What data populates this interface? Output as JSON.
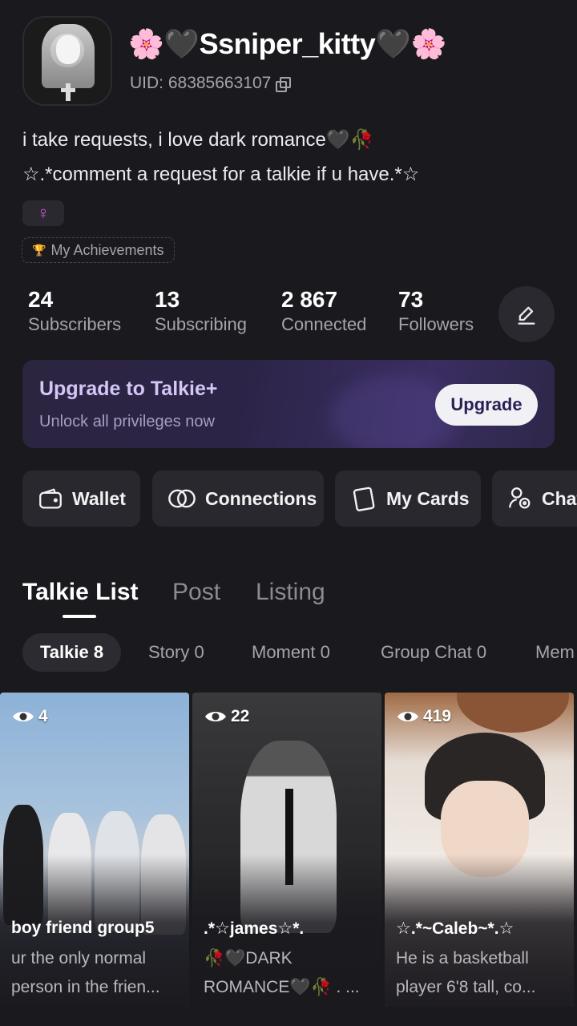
{
  "profile": {
    "username": "🌸🖤Ssniper_kitty🖤🌸",
    "uid": "UID: 68385663107",
    "bio_line1": "i take requests, i love dark romance🖤🥀",
    "bio_line2": "☆.*comment a request for a talkie if u have.*☆",
    "gender_symbol": "♀",
    "achievements_label": "My Achievements"
  },
  "stats": [
    {
      "value": "24",
      "label": "Subscribers"
    },
    {
      "value": "13",
      "label": "Subscribing"
    },
    {
      "value": "2 867",
      "label": "Connected"
    },
    {
      "value": "73",
      "label": "Followers"
    }
  ],
  "upgrade": {
    "title": "Upgrade to Talkie+",
    "subtitle": "Unlock all privileges now",
    "button": "Upgrade"
  },
  "quick_actions": [
    {
      "label": "Wallet",
      "icon": "wallet-icon"
    },
    {
      "label": "Connections",
      "icon": "connections-icon"
    },
    {
      "label": "My Cards",
      "icon": "cards-icon"
    },
    {
      "label": "Chat",
      "icon": "chat-icon"
    }
  ],
  "tabs": [
    {
      "label": "Talkie List",
      "active": true
    },
    {
      "label": "Post",
      "active": false
    },
    {
      "label": "Listing",
      "active": false
    }
  ],
  "chips": [
    {
      "label": "Talkie 8",
      "active": true
    },
    {
      "label": "Story 0",
      "active": false
    },
    {
      "label": "Moment 0",
      "active": false
    },
    {
      "label": "Group Chat 0",
      "active": false
    },
    {
      "label": "Mem",
      "active": false
    }
  ],
  "cards": [
    {
      "views": "4",
      "title": "boy friend group5",
      "desc": "ur the only normal person in the frien..."
    },
    {
      "views": "22",
      "title": ".*☆james☆*.",
      "desc": "🥀🖤DARK ROMANCE🖤🥀 . ..."
    },
    {
      "views": "419",
      "title": "☆.*~Caleb~*.☆",
      "desc": "He is a basketball player 6'8 tall, co..."
    }
  ]
}
